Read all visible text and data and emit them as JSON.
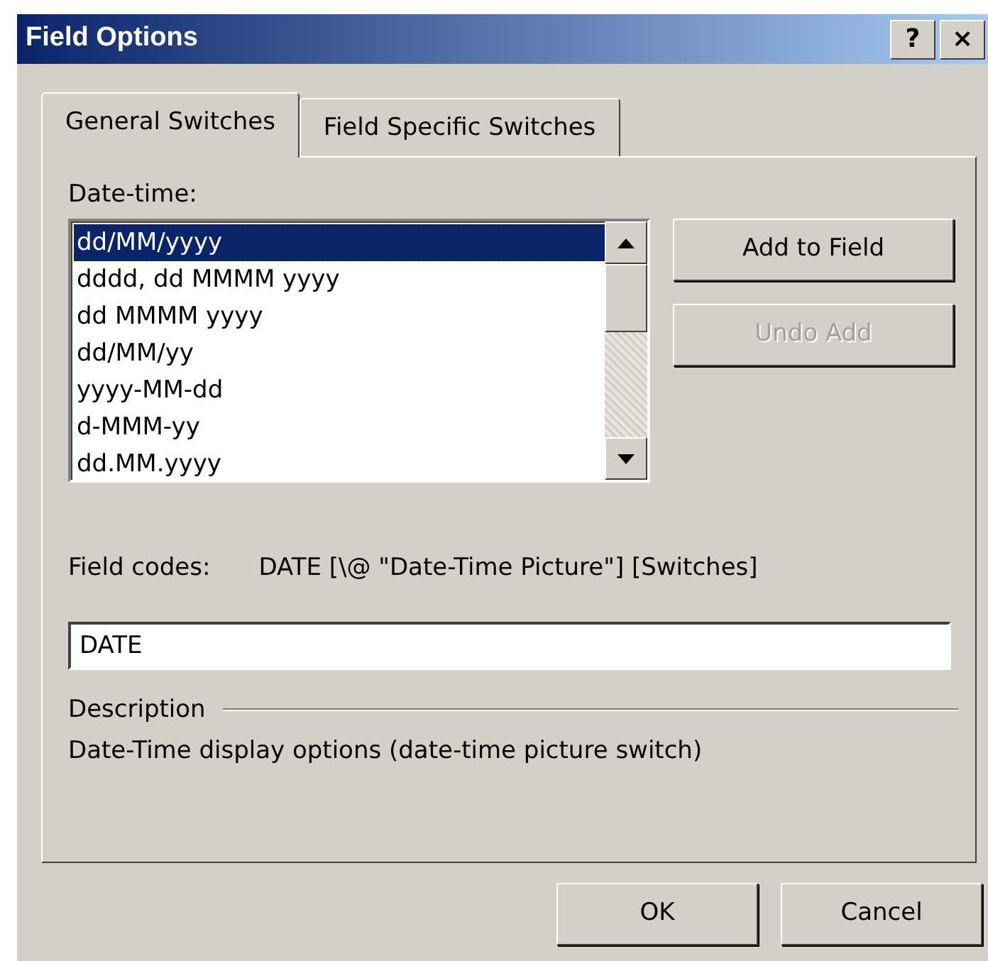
{
  "window": {
    "title": "Field Options",
    "title_buttons": [
      "?",
      "×"
    ]
  },
  "tabs": [
    {
      "label": "General Switches",
      "selected": true
    },
    {
      "label": "Field Specific Switches",
      "selected": false
    }
  ],
  "date_time": {
    "label": "Date-time:",
    "items": [
      {
        "text": "dd/MM/yyyy",
        "selected": true
      },
      {
        "text": "dddd, dd MMMM yyyy",
        "selected": false
      },
      {
        "text": "dd MMMM yyyy",
        "selected": false
      },
      {
        "text": "dd/MM/yy",
        "selected": false
      },
      {
        "text": "yyyy-MM-dd",
        "selected": false
      },
      {
        "text": "d-MMM-yy",
        "selected": false
      },
      {
        "text": "dd.MM.yyyy",
        "selected": false
      }
    ]
  },
  "side_buttons": [
    {
      "label": "Add to Field",
      "disabled": false
    },
    {
      "label": "Undo Add",
      "disabled": true
    }
  ],
  "field_codes": {
    "label": "Field codes:",
    "syntax": "DATE [\\@ \"Date-Time Picture\"] [Switches]",
    "value": "DATE"
  },
  "description": {
    "heading": "Description",
    "text": "Date-Time display options (date-time picture switch)"
  },
  "buttons": [
    "OK",
    "Cancel"
  ]
}
